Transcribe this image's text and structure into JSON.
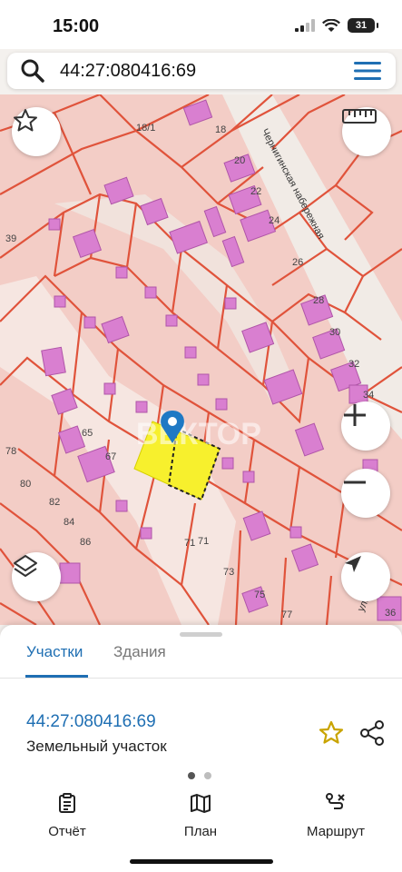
{
  "status": {
    "time": "15:00",
    "battery": "31"
  },
  "search": {
    "query": "44:27:080416:69"
  },
  "map": {
    "street_label": "Чернигинская набережная",
    "street_label_2": "улиц",
    "house_numbers": [
      "18/1",
      "18",
      "20",
      "22",
      "24",
      "26",
      "28",
      "30",
      "32",
      "34",
      "36",
      "39",
      "65",
      "67",
      "71",
      "71",
      "73",
      "75",
      "77",
      "78",
      "80",
      "82",
      "84",
      "86"
    ],
    "watermark": "ВЕКТОР",
    "colors": {
      "parcel_fill": "#f3cdc6",
      "parcel_line": "#e0533b",
      "building": "#d97fd0",
      "selected": "#f7f02d"
    }
  },
  "sheet": {
    "tab_parcels": "Участки",
    "tab_buildings": "Здания",
    "parcel_id": "44:27:080416:69",
    "parcel_type": "Земельный участок"
  },
  "nav": {
    "report": "Отчёт",
    "plan": "План",
    "route": "Маршрут"
  },
  "icons": [
    "search-icon",
    "menu-icon",
    "star-icon",
    "ruler-icon",
    "zoom-in-icon",
    "zoom-out-icon",
    "layers-icon",
    "locate-icon",
    "share-icon",
    "report-icon",
    "map-icon",
    "route-icon",
    "pin-icon"
  ]
}
